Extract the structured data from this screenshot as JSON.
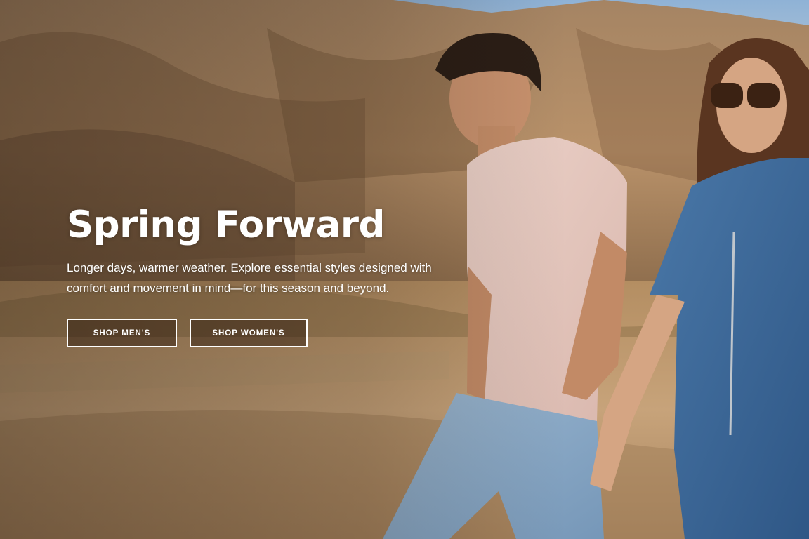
{
  "hero": {
    "title": "Spring Forward",
    "subtitle": "Longer days, warmer weather. Explore essential styles designed with comfort and movement in mind—for this season and beyond.",
    "buttons": {
      "shop_men": "SHOP MEN'S",
      "shop_women": "SHOP WOMEN'S"
    },
    "image": {
      "subject": "man-in-pink-tee-and-woman-in-denim-jumpsuit-walking-in-desert",
      "colors": {
        "sky": "#8fb2d6",
        "hills": "#a88460",
        "ground": "#c29a6e",
        "tee": "#e6c8c0",
        "jeans": "#8fb0cc",
        "denim": "#3f6a9c"
      }
    },
    "text_color": "#ffffff"
  }
}
